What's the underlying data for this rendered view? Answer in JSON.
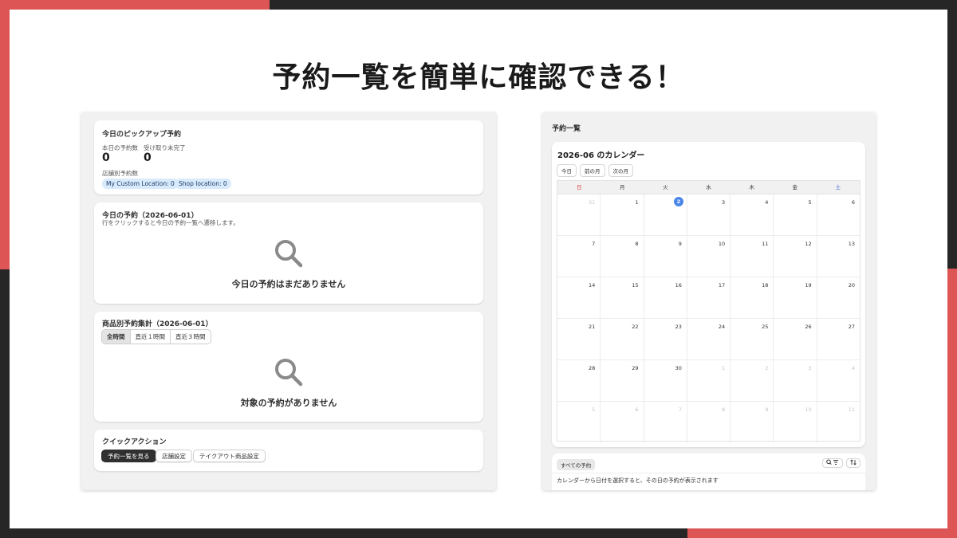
{
  "headline": "予約一覧を簡単に確認できる！",
  "colors": {
    "accent": "#dd5555",
    "dark": "#262626",
    "badge_bg": "#d8eafc",
    "today": "#4a86e8"
  },
  "left": {
    "pickup": {
      "title": "今日のピックアップ予約",
      "today_count_label": "本日の予約数",
      "today_count": "0",
      "pending_label": "受け取り未完了",
      "pending_count": "0",
      "by_store_label": "店舗別予約数",
      "locations": [
        "My Custom Location: 0",
        "Shop location: 0"
      ]
    },
    "today_reservations": {
      "title": "今日の予約（2026-06-01）",
      "subtitle": "行をクリックすると今日の予約一覧へ遷移します。",
      "empty_icon": "search-icon",
      "empty_text": "今日の予約はまだありません"
    },
    "product_summary": {
      "title": "商品別予約集計（2026-06-01）",
      "filters": [
        "全時間",
        "直近１時間",
        "直近３時間"
      ],
      "active_filter": "全時間",
      "empty_icon": "search-icon",
      "empty_text": "対象の予約がありません"
    },
    "quick_actions": {
      "title": "クイックアクション",
      "buttons": [
        "予約一覧を見る",
        "店舗設定",
        "テイクアウト商品設定"
      ]
    }
  },
  "right": {
    "title": "予約一覧",
    "calendar": {
      "title": "2026-06 のカレンダー",
      "nav": [
        "今日",
        "前の月",
        "次の月"
      ],
      "weekdays": [
        "日",
        "月",
        "火",
        "水",
        "木",
        "金",
        "土"
      ],
      "weeks": [
        [
          "31",
          "1",
          "2",
          "3",
          "4",
          "5",
          "6"
        ],
        [
          "7",
          "8",
          "9",
          "10",
          "11",
          "12",
          "13"
        ],
        [
          "14",
          "15",
          "16",
          "17",
          "18",
          "19",
          "20"
        ],
        [
          "21",
          "22",
          "23",
          "24",
          "25",
          "26",
          "27"
        ],
        [
          "28",
          "29",
          "30",
          "1",
          "2",
          "3",
          "4"
        ],
        [
          "5",
          "6",
          "7",
          "8",
          "9",
          "10",
          "11"
        ]
      ],
      "today": "2"
    },
    "list": {
      "tab": "すべての予約",
      "search_filter_icon": "search-filter-icon",
      "sort_icon": "sort-icon",
      "message": "カレンダーから日付を選択すると、その日の予約が表示されます"
    }
  }
}
